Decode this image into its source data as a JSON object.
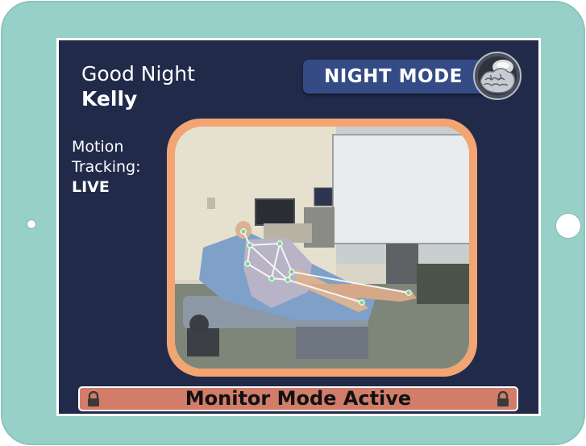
{
  "greeting": {
    "salutation": "Good Night",
    "name": "Kelly"
  },
  "night_mode": {
    "label": "NIGHT MODE",
    "icon": "brain-icon"
  },
  "motion": {
    "line1": "Motion",
    "line2": "Tracking:",
    "status": "LIVE"
  },
  "camera_feed": {
    "icon": "patient-skeleton-overlay"
  },
  "status_bar": {
    "text": "Monitor Mode Active",
    "icon": "lock-icon"
  },
  "colors": {
    "bezel": "#97d0c9",
    "screen": "#222a49",
    "night_button": "#344b86",
    "video_frame": "#f2a572",
    "status_bar": "#d17d6a"
  }
}
